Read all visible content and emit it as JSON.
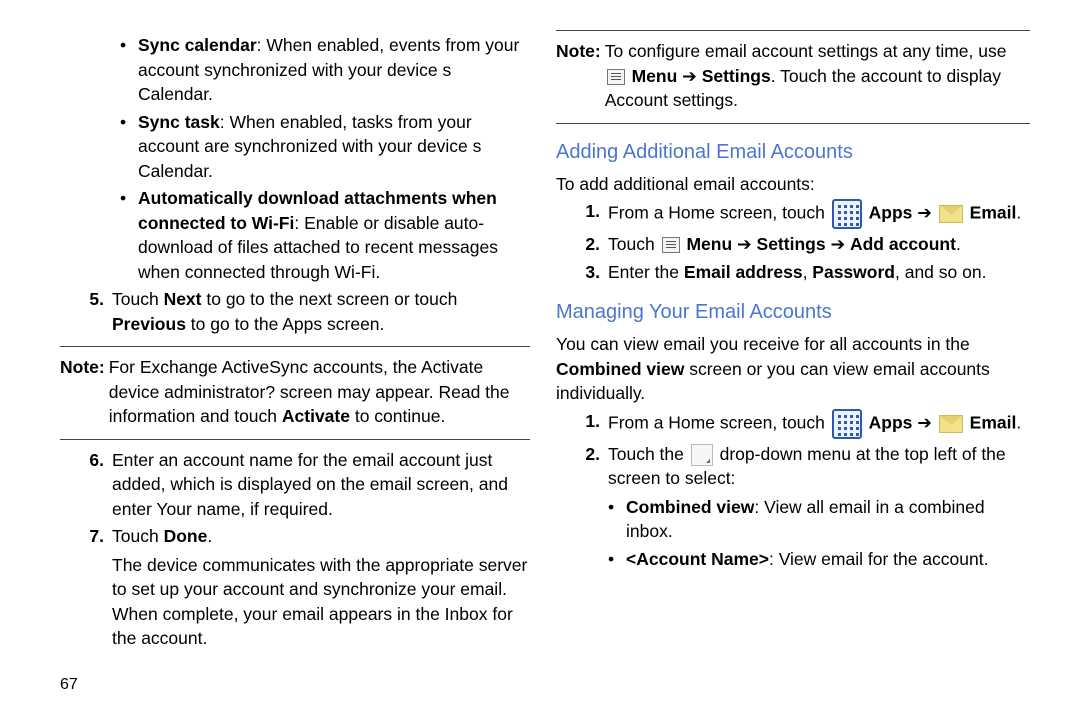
{
  "left": {
    "bullets": [
      {
        "title": "Sync calendar",
        "text": ": When enabled, events from your account synchronized with your device s Calendar."
      },
      {
        "title": "Sync task",
        "text": ": When enabled, tasks from your account are synchronized with your device s Calendar."
      },
      {
        "title": "Automatically download attachments when connected to Wi-Fi",
        "text": ": Enable or disable auto-download of files attached to recent messages when connected through Wi-Fi."
      }
    ],
    "step5_num": "5.",
    "step5_a": "Touch ",
    "step5_b": "Next",
    "step5_c": " to go to the next screen or touch ",
    "step5_d": "Previous",
    "step5_e": " to go to the Apps screen.",
    "note1_label": "Note:",
    "note1_a": " For Exchange ActiveSync accounts, the Activate device administrator? screen may appear. Read the information and touch ",
    "note1_b": "Activate",
    "note1_c": " to continue.",
    "step6_num": "6.",
    "step6": "Enter an account name for the email account just added, which is displayed on the email screen, and enter Your name, if required.",
    "step7_num": "7.",
    "step7_a": "Touch ",
    "step7_b": "Done",
    "step7_c": ".",
    "step7_follow": "The device communicates with the appropriate server to set up your account and synchronize your email. When complete, your email appears in the Inbox for the account."
  },
  "right": {
    "note_top_label": "Note:",
    "note_top_a": " To configure email account settings at any time, use ",
    "note_top_menu": "Menu",
    "note_top_arrow": " ➔ ",
    "note_top_settings": "Settings",
    "note_top_tail": ". Touch the account to display Account settings.",
    "h_add": "Adding Additional Email Accounts",
    "add_intro": "To add additional email accounts:",
    "add1_num": "1.",
    "add1_a": "From a Home screen, touch ",
    "add1_apps": "Apps",
    "add1_arrow": " ➔ ",
    "add1_email": "Email",
    "add1_dot": ".",
    "add2_num": "2.",
    "add2_a": "Touch ",
    "add2_menu": "Menu",
    "add2_arrow1": " ➔ ",
    "add2_settings": "Settings",
    "add2_arrow2": " ➔ ",
    "add2_addacct": "Add account",
    "add2_dot": ".",
    "add3_num": "3.",
    "add3_a": "Enter the ",
    "add3_b": "Email address",
    "add3_c": ", ",
    "add3_d": "Password",
    "add3_e": ", and so on.",
    "h_manage": "Managing Your Email Accounts",
    "manage_intro_a": "You can view email you receive for all accounts in the ",
    "manage_intro_b": "Combined view",
    "manage_intro_c": " screen or you can view email accounts individually.",
    "mg1_num": "1.",
    "mg1_a": "From a Home screen, touch ",
    "mg1_apps": "Apps",
    "mg1_arrow": " ➔ ",
    "mg1_email": "Email",
    "mg1_dot": ".",
    "mg2_num": "2.",
    "mg2_a": "Touch the ",
    "mg2_b": " drop-down menu at the top left of the screen to select:",
    "mg_b1_title": "Combined view",
    "mg_b1_text": ": View all email in a combined inbox.",
    "mg_b2_title": "<Account Name>",
    "mg_b2_text": ": View email for the account."
  },
  "page_number": "67"
}
